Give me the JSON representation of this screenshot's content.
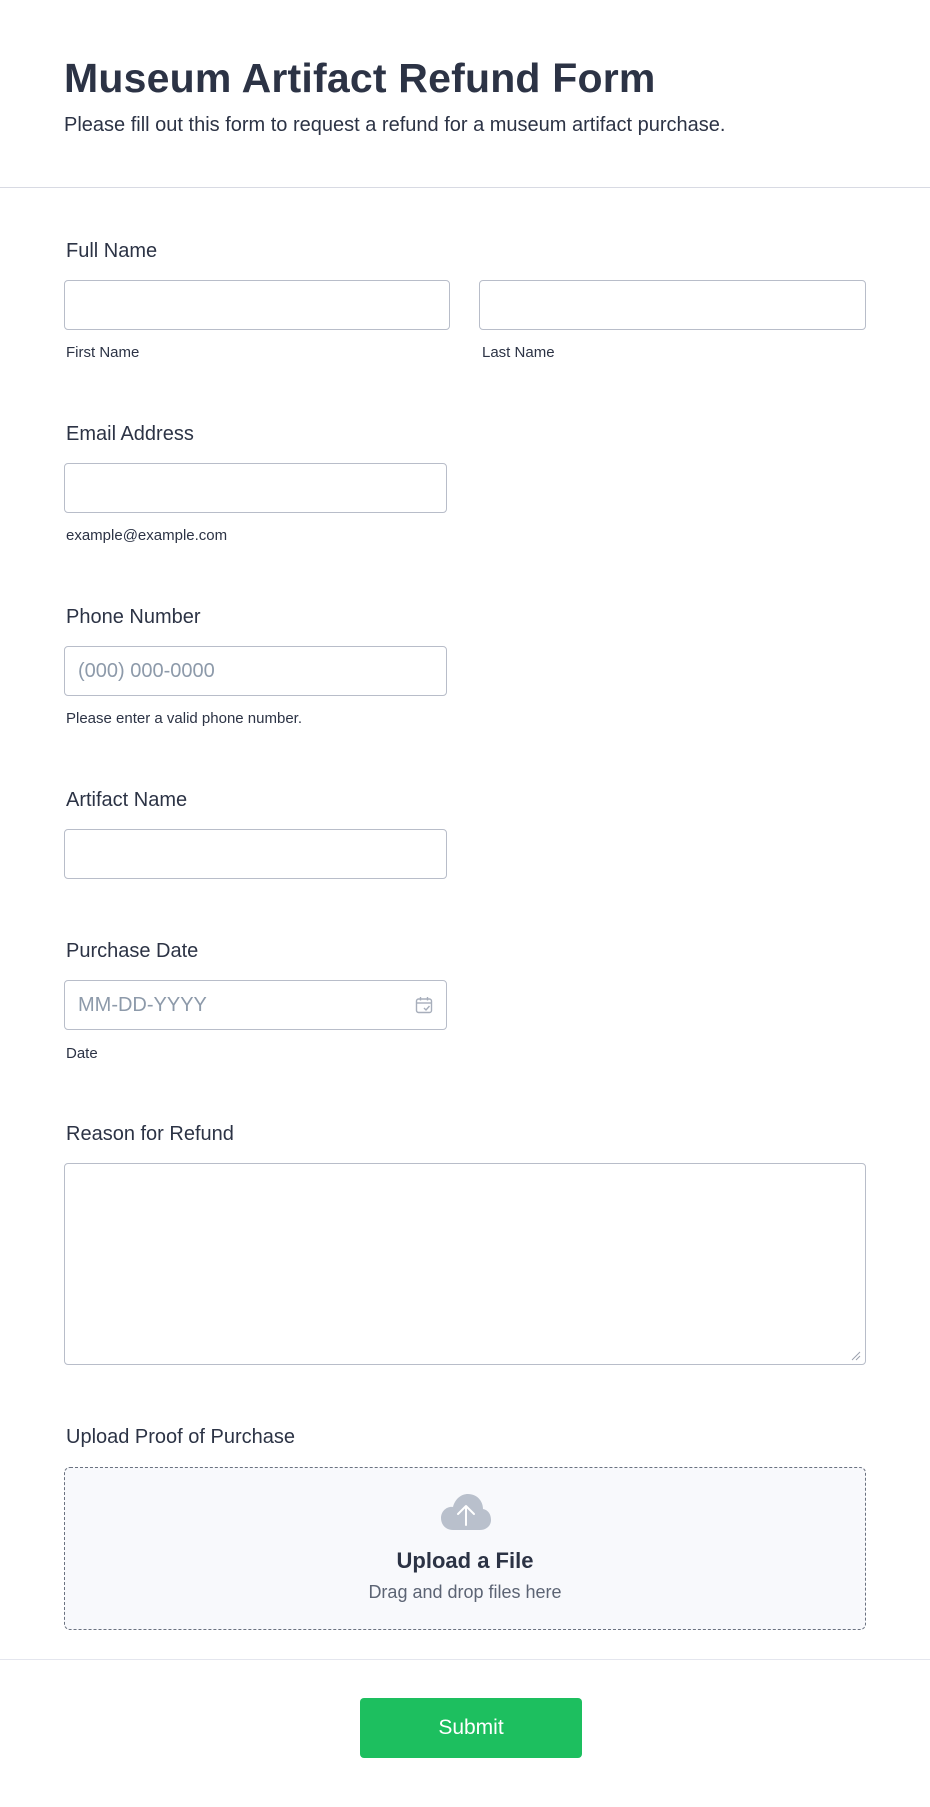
{
  "form": {
    "title": "Museum Artifact Refund Form",
    "subtitle": "Please fill out this form to request a refund for a museum artifact purchase."
  },
  "full_name": {
    "label": "Full Name",
    "first_label": "First Name",
    "last_label": "Last Name",
    "first_value": "",
    "last_value": ""
  },
  "email": {
    "label": "Email Address",
    "value": "",
    "sublabel": "example@example.com"
  },
  "phone": {
    "label": "Phone Number",
    "placeholder": "(000) 000-0000",
    "sublabel": "Please enter a valid phone number."
  },
  "artifact": {
    "label": "Artifact Name",
    "value": ""
  },
  "purchase_date": {
    "label": "Purchase Date",
    "placeholder": "MM-DD-YYYY",
    "sublabel": "Date",
    "icon": "calendar-icon"
  },
  "reason": {
    "label": "Reason for Refund",
    "value": ""
  },
  "upload": {
    "label": "Upload Proof of Purchase",
    "title": "Upload a File",
    "subtitle": "Drag and drop files here",
    "icon": "cloud-upload-icon"
  },
  "submit": {
    "label": "Submit",
    "color": "#1dbf5f"
  }
}
